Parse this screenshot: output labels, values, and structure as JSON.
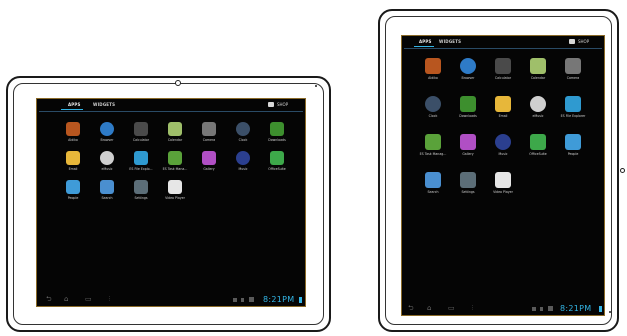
{
  "colors": {
    "accent": "#33b5e5",
    "bezel": "#ffffff",
    "screen": "#050505",
    "rim": "#8a6a28"
  },
  "tabs": {
    "apps": "APPS",
    "widgets": "WIDGETS",
    "shop": "SHOP"
  },
  "landscape": {
    "clock": "8:21PM",
    "apps": [
      {
        "label": "Aldiko",
        "icon": "books-icon",
        "color": "#b8561f"
      },
      {
        "label": "Browser",
        "icon": "globe-icon",
        "color": "#2e7bc7"
      },
      {
        "label": "Calculator",
        "icon": "calculator-icon",
        "color": "#4a4a4a"
      },
      {
        "label": "Calendar",
        "icon": "calendar-icon",
        "color": "#9fbf6a"
      },
      {
        "label": "Camera",
        "icon": "camera-icon",
        "color": "#777777"
      },
      {
        "label": "Clock",
        "icon": "clock-icon",
        "color": "#3b4f68"
      },
      {
        "label": "Downloads",
        "icon": "download-icon",
        "color": "#3d8f2e"
      },
      {
        "label": "Email",
        "icon": "email-icon",
        "color": "#e7b73a"
      },
      {
        "label": "eMusic",
        "icon": "emusic-icon",
        "color": "#cfcfcf"
      },
      {
        "label": "ES File Explo...",
        "icon": "es-file-icon",
        "color": "#2f9ad0"
      },
      {
        "label": "ES Task Mana...",
        "icon": "task-manager-icon",
        "color": "#5aa23a"
      },
      {
        "label": "Gallery",
        "icon": "gallery-icon",
        "color": "#b04fc4"
      },
      {
        "label": "Music",
        "icon": "music-icon",
        "color": "#2b3f8f"
      },
      {
        "label": "OfficeSuite",
        "icon": "officesuite-icon",
        "color": "#3da84a"
      },
      {
        "label": "People",
        "icon": "people-icon",
        "color": "#3f9bd8"
      },
      {
        "label": "Search",
        "icon": "search-icon",
        "color": "#4a8fd0"
      },
      {
        "label": "Settings",
        "icon": "settings-icon",
        "color": "#5c6e78"
      },
      {
        "label": "Video Player",
        "icon": "youtube-icon",
        "color": "#e6e6e6"
      }
    ]
  },
  "portrait": {
    "clock": "8:21PM",
    "apps": [
      {
        "label": "Aldiko",
        "icon": "books-icon",
        "color": "#b8561f"
      },
      {
        "label": "Browser",
        "icon": "globe-icon",
        "color": "#2e7bc7"
      },
      {
        "label": "Calculator",
        "icon": "calculator-icon",
        "color": "#4a4a4a"
      },
      {
        "label": "Calendar",
        "icon": "calendar-icon",
        "color": "#9fbf6a"
      },
      {
        "label": "Camera",
        "icon": "camera-icon",
        "color": "#777777"
      },
      {
        "label": "Clock",
        "icon": "clock-icon",
        "color": "#3b4f68"
      },
      {
        "label": "Downloads",
        "icon": "download-icon",
        "color": "#3d8f2e"
      },
      {
        "label": "Email",
        "icon": "email-icon",
        "color": "#e7b73a"
      },
      {
        "label": "eMusic",
        "icon": "emusic-icon",
        "color": "#cfcfcf"
      },
      {
        "label": "ES File Explorer",
        "icon": "es-file-icon",
        "color": "#2f9ad0"
      },
      {
        "label": "ES Task Manag...",
        "icon": "task-manager-icon",
        "color": "#5aa23a"
      },
      {
        "label": "Gallery",
        "icon": "gallery-icon",
        "color": "#b04fc4"
      },
      {
        "label": "Music",
        "icon": "music-icon",
        "color": "#2b3f8f"
      },
      {
        "label": "OfficeSuite",
        "icon": "officesuite-icon",
        "color": "#3da84a"
      },
      {
        "label": "People",
        "icon": "people-icon",
        "color": "#3f9bd8"
      },
      {
        "label": "Search",
        "icon": "search-icon",
        "color": "#4a8fd0"
      },
      {
        "label": "Settings",
        "icon": "settings-icon",
        "color": "#5c6e78"
      },
      {
        "label": "Video Player",
        "icon": "youtube-icon",
        "color": "#e6e6e6"
      }
    ]
  }
}
